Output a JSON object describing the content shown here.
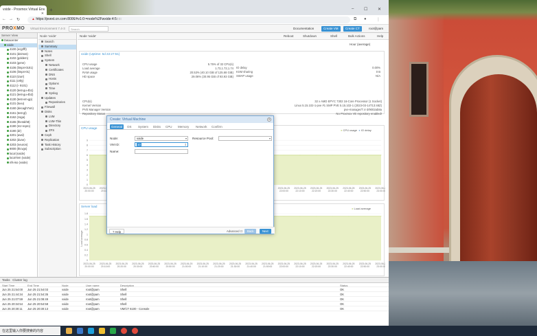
{
  "browser": {
    "tab_title": "vxide - Proxmox Virtual Env",
    "url": "https://pvext.cn.com:8006/#v1:0:=node%2Fwxide:4:5:::::",
    "new_tab": "+"
  },
  "pve": {
    "logo_a": "PRO",
    "logo_x": "X",
    "logo_b": "MO",
    "version": "Virtual Environment 7.4-3",
    "search_placeholder": "Search",
    "doc_label": "Documentation",
    "create_vm_label": "Create VM",
    "create_ct_label": "Create CT",
    "user_label": "root@pam"
  },
  "tree": {
    "header": "Server View",
    "items": [
      {
        "label": "Datacenter",
        "indent": 0,
        "sel": false
      },
      {
        "label": "vxide",
        "indent": 1,
        "sel": true
      },
      {
        "label": "4100 (ecgrfft)",
        "indent": 2,
        "sel": false
      },
      {
        "label": "4101 (deimos)",
        "indent": 2,
        "sel": false
      },
      {
        "label": "4102 (goldem)",
        "indent": 2,
        "sel": false
      },
      {
        "label": "4103 (gene)",
        "indent": 2,
        "sel": false
      },
      {
        "label": "4106 (limp4-0101)",
        "indent": 2,
        "sel": false
      },
      {
        "label": "4106 (limp4-01)",
        "indent": 2,
        "sel": false
      },
      {
        "label": "4110 (tzurr)",
        "indent": 2,
        "sel": false
      },
      {
        "label": "4111 (ortly)",
        "indent": 2,
        "sel": false
      },
      {
        "label": "4112 (i- 9101)",
        "indent": 2,
        "sel": false
      },
      {
        "label": "4120 (test-gu-4b1)",
        "indent": 2,
        "sel": false
      },
      {
        "label": "4121 (test-gu-4b2)",
        "indent": 2,
        "sel": false
      },
      {
        "label": "4130 (test-vm-gp)",
        "indent": 2,
        "sel": false
      },
      {
        "label": "4131 (tuvu)",
        "indent": 2,
        "sel": false
      },
      {
        "label": "4160 (decagh7vm)",
        "indent": 2,
        "sel": false
      },
      {
        "label": "4161 (test-gl)",
        "indent": 2,
        "sel": false
      },
      {
        "label": "4162 (zoga)",
        "indent": 2,
        "sel": false
      },
      {
        "label": "4165 (therakh8)",
        "indent": 2,
        "sel": false
      },
      {
        "label": "4190 (mz-repro)",
        "indent": 2,
        "sel": false
      },
      {
        "label": "4190 (dr)",
        "indent": 2,
        "sel": false
      },
      {
        "label": "4201 (aval)",
        "indent": 2,
        "sel": false
      },
      {
        "label": "4202 (dune)",
        "indent": 2,
        "sel": false
      },
      {
        "label": "4203 (neuron)",
        "indent": 2,
        "sel": false
      },
      {
        "label": "9000 (thcvgs)",
        "indent": 2,
        "sel": false
      },
      {
        "label": "local (vxide)",
        "indent": 2,
        "sel": false
      },
      {
        "label": "local-lvm (vxide)",
        "indent": 2,
        "sel": false
      },
      {
        "label": "nfs-iso (vxide)",
        "indent": 2,
        "sel": false
      }
    ]
  },
  "nav": {
    "top": "Node 'vxide'",
    "items": [
      {
        "label": "Search",
        "sub": false,
        "sel": false
      },
      {
        "label": "Summary",
        "sub": false,
        "sel": true
      },
      {
        "label": "Notes",
        "sub": false,
        "sel": false
      },
      {
        "label": "Shell",
        "sub": false,
        "sel": false
      },
      {
        "label": "System",
        "sub": false,
        "sel": false
      },
      {
        "label": "Network",
        "sub": true,
        "sel": false
      },
      {
        "label": "Certificates",
        "sub": true,
        "sel": false
      },
      {
        "label": "DNS",
        "sub": true,
        "sel": false
      },
      {
        "label": "Hosts",
        "sub": true,
        "sel": false
      },
      {
        "label": "Options",
        "sub": true,
        "sel": false
      },
      {
        "label": "Time",
        "sub": true,
        "sel": false
      },
      {
        "label": "Syslog",
        "sub": true,
        "sel": false
      },
      {
        "label": "Updates",
        "sub": false,
        "sel": false
      },
      {
        "label": "Repositories",
        "sub": true,
        "sel": false
      },
      {
        "label": "Firewall",
        "sub": false,
        "sel": false
      },
      {
        "label": "Disks",
        "sub": false,
        "sel": false
      },
      {
        "label": "LVM",
        "sub": true,
        "sel": false
      },
      {
        "label": "LVM-Thin",
        "sub": true,
        "sel": false
      },
      {
        "label": "Directory",
        "sub": true,
        "sel": false
      },
      {
        "label": "ZFS",
        "sub": true,
        "sel": false
      },
      {
        "label": "Ceph",
        "sub": false,
        "sel": false
      },
      {
        "label": "Replication",
        "sub": false,
        "sel": false
      },
      {
        "label": "Task History",
        "sub": false,
        "sel": false
      },
      {
        "label": "Subscription",
        "sub": false,
        "sel": false
      }
    ]
  },
  "content": {
    "toolbar": {
      "title": "Node 'vxide'",
      "reboot": "Reboot",
      "shutdown": "Shutdown",
      "shell": "Shell",
      "bulk": "Bulk Actions",
      "help": "Help",
      "range": "Hour (average)"
    },
    "status_title": "vxide (Uptime: 5d 22:27:51)",
    "kv_left": [
      {
        "k": "CPU usage",
        "v": "5.75% of 32 CPU(s)"
      },
      {
        "k": "Load average",
        "v": "1.73,1.72,1.74"
      },
      {
        "k": "RAM usage",
        "v": "20.53% (40.10 GiB of 125.68 GiB)"
      },
      {
        "k": "HD space",
        "v": "29.06% (30.95 GiB of 93.93 GiB)"
      }
    ],
    "kv_right": [
      {
        "k": "IO delay",
        "v": "0.00%"
      },
      {
        "k": "KSM sharing",
        "v": "0 B"
      },
      {
        "k": "SWAP usage",
        "v": "N/A"
      }
    ],
    "info_rows": [
      {
        "k": "CPU(s)",
        "v": "32 x AMD EPYC 7302 16-Core Processor (1 Socket)"
      },
      {
        "k": "Kernel Version",
        "v": "Linux 5.15.102-1-pve #1 SMP PVE 5.15.102-1 (2023-03-14T13:48Z)"
      },
      {
        "k": "PVE Manager Version",
        "v": "pve-manager/7.4-3/9002ab8a"
      },
      {
        "k": "Repository Status",
        "v": "No Proxmox VE repository enabled!"
      }
    ],
    "cpu_title": "CPU usage",
    "cpu_legend": [
      "CPU usage",
      "IO delay"
    ],
    "load_title": "Server load",
    "load_legend": [
      "Load average"
    ],
    "load_ylabel": "Load average",
    "x_ticks": [
      "2023-06-25\n20:00:00",
      "2023-06-25\n20:10:00",
      "2023-06-25\n20:20:00",
      "2023-06-25\n20:30:00",
      "2023-06-25\n20:40:00",
      "2023-06-25\n20:50:00",
      "2023-06-25\n21:00:00",
      "2023-06-25\n21:10:00",
      "2023-06-25\n21:20:00",
      "2023-06-25\n21:30:00",
      "2023-06-25\n21:40:00",
      "2023-06-25\n21:50:00",
      "2023-06-25\n22:00:00",
      "2023-06-25\n22:10:00",
      "2023-06-25\n22:20:00",
      "2023-06-25\n22:30:00",
      "2023-06-25\n22:40:00",
      "2023-06-25\n22:50:00",
      "2023-06-25\n23:00:00"
    ]
  },
  "chart_data": [
    {
      "type": "area",
      "title": "CPU usage",
      "ylim": [
        0,
        10
      ],
      "y_ticks": [
        0,
        1,
        2,
        3,
        4,
        5,
        6,
        7,
        8,
        9
      ],
      "series": [
        {
          "name": "CPU usage",
          "values": [
            6,
            6,
            6,
            6,
            6,
            6,
            6,
            6,
            6,
            6,
            6,
            6,
            6,
            6,
            6,
            6,
            6,
            6,
            6
          ]
        }
      ]
    },
    {
      "type": "area",
      "title": "Server load",
      "ylim": [
        0,
        1.8
      ],
      "y_ticks": [
        0,
        0.2,
        0.4,
        0.6,
        0.8,
        1.0,
        1.2,
        1.4,
        1.6,
        1.8
      ],
      "series": [
        {
          "name": "Load average",
          "values": [
            1.7,
            1.7,
            1.7,
            1.7,
            1.7,
            1.7,
            1.7,
            1.7,
            1.7,
            1.7,
            1.7,
            1.7,
            1.7,
            1.7,
            1.7,
            1.7,
            1.7,
            1.7,
            1.7
          ]
        }
      ]
    }
  ],
  "tasks": {
    "bar": "Cluster log",
    "tab": "Tasks",
    "headers": [
      "Start Time",
      "End Time",
      "Node",
      "User name",
      "Description",
      "Status"
    ],
    "rows": [
      [
        "Jun 25 21:54:00",
        "Jun 25 21:54:03",
        "vxide",
        "root@pam",
        "Shell",
        "OK"
      ],
      [
        "Jun 25 21:44:34",
        "Jun 25 21:54:35",
        "vxide",
        "root@pam",
        "Shell",
        "OK"
      ],
      [
        "Jun 25 21:07:59",
        "Jun 25 21:08:49",
        "vxide",
        "root@pam",
        "Shell",
        "OK"
      ],
      [
        "Jun 25 20:34:54",
        "Jun 25 20:54:58",
        "vxide",
        "root@pam",
        "Shell",
        "OK"
      ],
      [
        "Jun 25 20:30:11",
        "Jun 25 20:30:13",
        "vxide",
        "root@pam",
        "VM/CT 6100 - Console",
        "OK"
      ]
    ]
  },
  "dialog": {
    "title": "Create: Virtual Machine",
    "tabs": [
      "General",
      "OS",
      "System",
      "Disks",
      "CPU",
      "Memory",
      "Network",
      "Confirm"
    ],
    "node_label": "Node:",
    "node_value": "vxide",
    "vmid_label": "VM ID:",
    "vmid_value": "10",
    "name_label": "Name:",
    "name_value": "",
    "pool_label": "Resource Pool:",
    "pool_value": "",
    "help": "Help",
    "advanced": "Advanced",
    "back": "Back",
    "next": "Next"
  },
  "taskbar": {
    "search": "在这里输入你要搜索的内容"
  },
  "colors": {
    "accent": "#3892d4",
    "chart_fill": "#e9f0c7",
    "chart_line": "#c9d98a"
  }
}
